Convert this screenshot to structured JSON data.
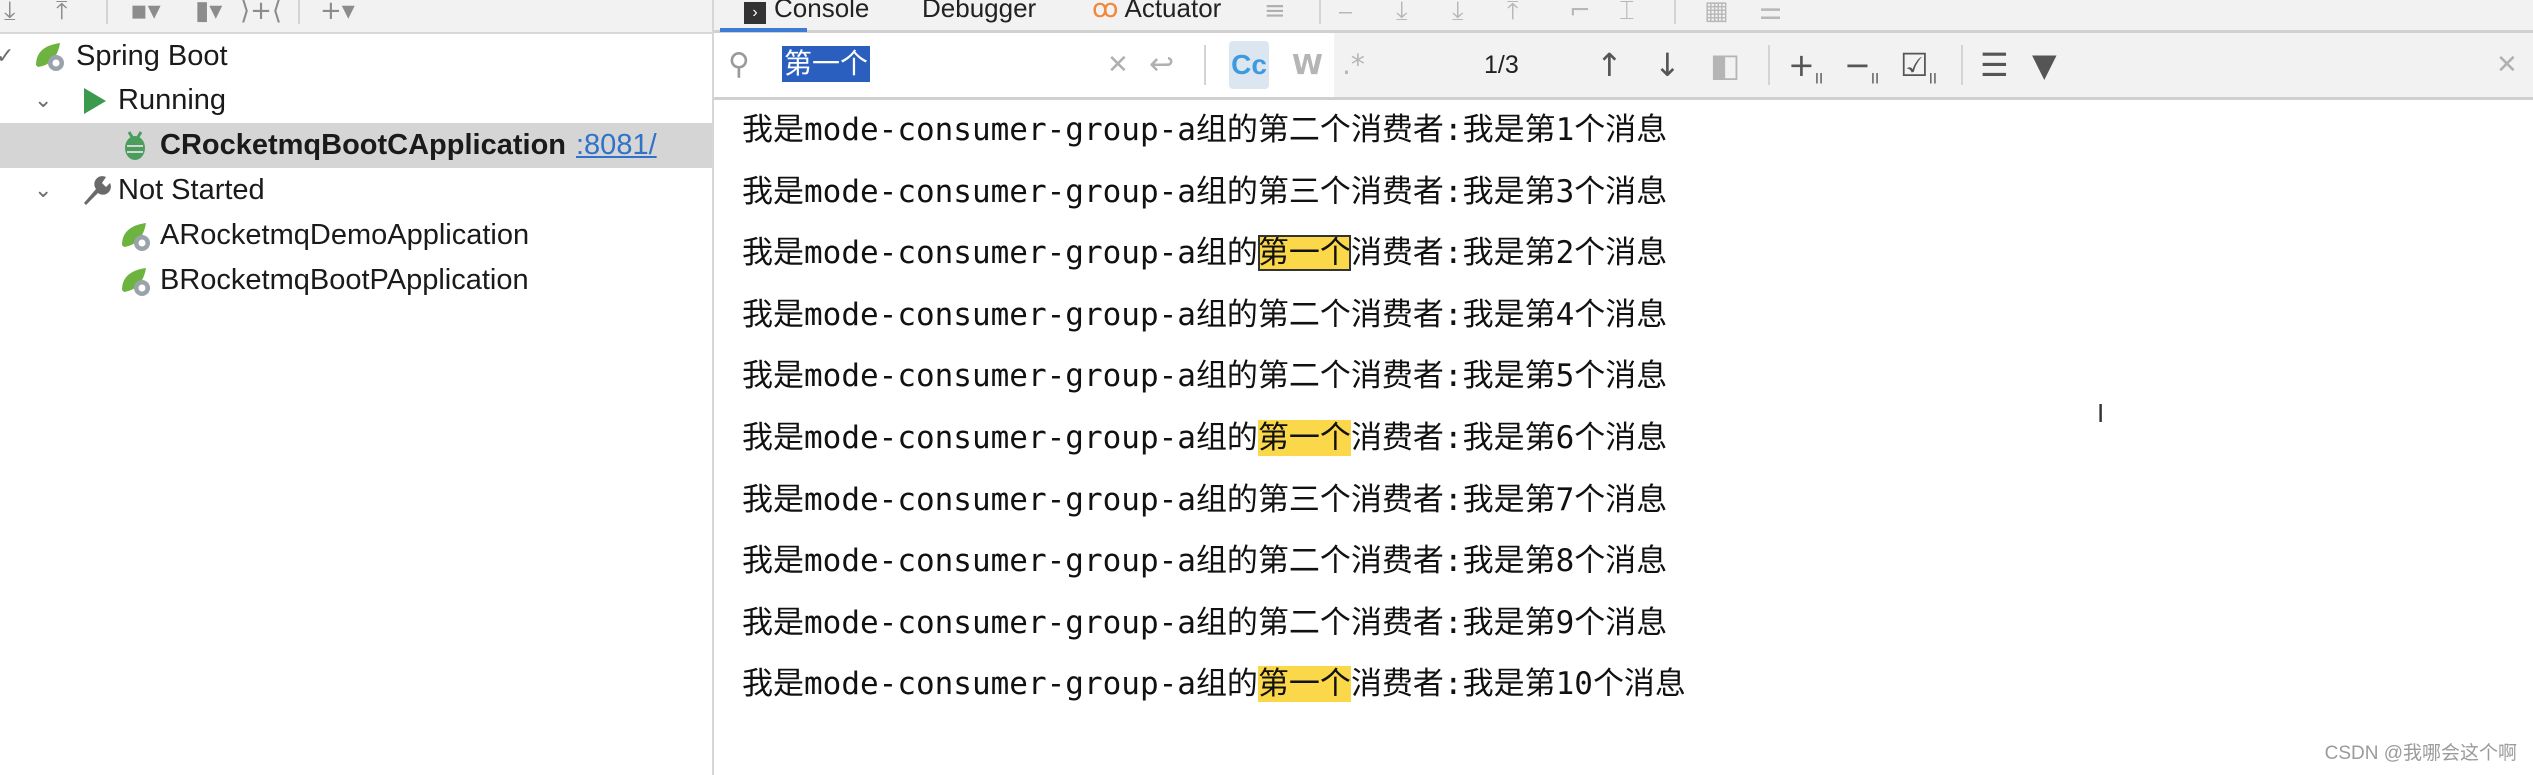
{
  "services_panel": {
    "tree": [
      {
        "label": "Spring Boot",
        "icon": "spring-boot-icon",
        "expanded": true,
        "level": 0
      },
      {
        "label": "Running",
        "icon": "run-icon",
        "expanded": true,
        "level": 1
      },
      {
        "label": "CRocketmqBootCApplication",
        "link": ":8081/",
        "icon": "debug-bug-icon",
        "level": 2,
        "selected": true
      },
      {
        "label": "Not Started",
        "icon": "wrench-icon",
        "expanded": true,
        "level": 1
      },
      {
        "label": "ARocketmqDemoApplication",
        "icon": "spring-boot-icon",
        "level": 2
      },
      {
        "label": "BRocketmqBootPApplication",
        "icon": "spring-boot-icon",
        "level": 2
      }
    ]
  },
  "console_panel": {
    "tabs": [
      {
        "label": "Console",
        "active": true
      },
      {
        "label": "Debugger",
        "active": false
      },
      {
        "label": "Actuator",
        "active": false
      }
    ],
    "search": {
      "query": "第一个",
      "match_counter": "1/3",
      "match_case_label": "Cc",
      "words_label": "W",
      "regex_label": ".*"
    },
    "lines": [
      {
        "prefix": "我是",
        "mono1": "mode-consumer-group-a",
        "mid": "组的",
        "ordinal": "第二个",
        "suffix1": "消费者",
        "colon": ":",
        "msg1": "我是第",
        "num": "1",
        "msg2": "个消息",
        "highlight": false
      },
      {
        "prefix": "我是",
        "mono1": "mode-consumer-group-a",
        "mid": "组的",
        "ordinal": "第三个",
        "suffix1": "消费者",
        "colon": ":",
        "msg1": "我是第",
        "num": "3",
        "msg2": "个消息",
        "highlight": false
      },
      {
        "prefix": "我是",
        "mono1": "mode-consumer-group-a",
        "mid": "组的",
        "ordinal": "第一个",
        "suffix1": "消费者",
        "colon": ":",
        "msg1": "我是第",
        "num": "2",
        "msg2": "个消息",
        "highlight": true,
        "current": true
      },
      {
        "prefix": "我是",
        "mono1": "mode-consumer-group-a",
        "mid": "组的",
        "ordinal": "第二个",
        "suffix1": "消费者",
        "colon": ":",
        "msg1": "我是第",
        "num": "4",
        "msg2": "个消息",
        "highlight": false
      },
      {
        "prefix": "我是",
        "mono1": "mode-consumer-group-a",
        "mid": "组的",
        "ordinal": "第二个",
        "suffix1": "消费者",
        "colon": ":",
        "msg1": "我是第",
        "num": "5",
        "msg2": "个消息",
        "highlight": false
      },
      {
        "prefix": "我是",
        "mono1": "mode-consumer-group-a",
        "mid": "组的",
        "ordinal": "第一个",
        "suffix1": "消费者",
        "colon": ":",
        "msg1": "我是第",
        "num": "6",
        "msg2": "个消息",
        "highlight": true
      },
      {
        "prefix": "我是",
        "mono1": "mode-consumer-group-a",
        "mid": "组的",
        "ordinal": "第三个",
        "suffix1": "消费者",
        "colon": ":",
        "msg1": "我是第",
        "num": "7",
        "msg2": "个消息",
        "highlight": false
      },
      {
        "prefix": "我是",
        "mono1": "mode-consumer-group-a",
        "mid": "组的",
        "ordinal": "第二个",
        "suffix1": "消费者",
        "colon": ":",
        "msg1": "我是第",
        "num": "8",
        "msg2": "个消息",
        "highlight": false
      },
      {
        "prefix": "我是",
        "mono1": "mode-consumer-group-a",
        "mid": "组的",
        "ordinal": "第二个",
        "suffix1": "消费者",
        "colon": ":",
        "msg1": "我是第",
        "num": "9",
        "msg2": "个消息",
        "highlight": false
      },
      {
        "prefix": "我是",
        "mono1": "mode-consumer-group-a",
        "mid": "组的",
        "ordinal": "第一个",
        "suffix1": "消费者",
        "colon": ":",
        "msg1": "我是第",
        "num": "10",
        "msg2": "个消息",
        "highlight": true
      }
    ]
  },
  "watermark": "CSDN @我哪会这个啊",
  "colors": {
    "highlight": "#fbd84a",
    "selection": "#2b5fbf",
    "selected_row": "#d5d5d5",
    "link": "#2f72c8",
    "spring_green": "#6db33f",
    "tab_accent": "#3d7bd4"
  }
}
